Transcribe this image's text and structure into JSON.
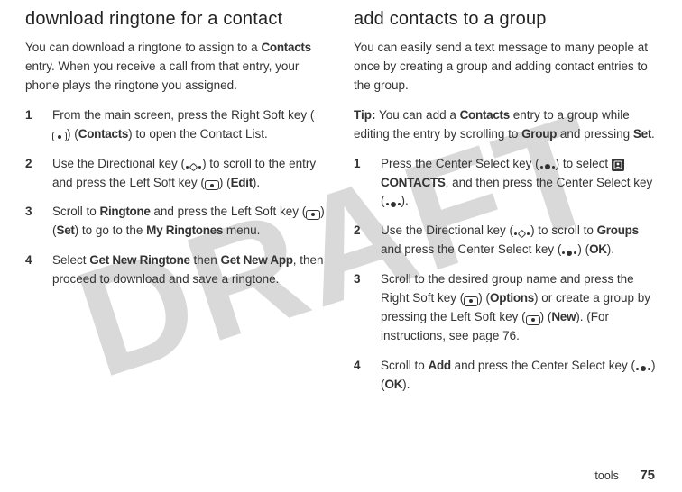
{
  "watermark": "DRAFT",
  "left": {
    "heading": "download ringtone for a contact",
    "intro_parts": [
      "You can download a ringtone to assign to a ",
      "Contacts",
      " entry. When you receive a call from that entry, your phone plays the ringtone you assigned."
    ],
    "steps": [
      {
        "n": "1",
        "parts": [
          "From the main screen, press the Right Soft key (",
          "ICON_SOFT",
          ") (",
          "Contacts",
          ") to open the Contact List."
        ]
      },
      {
        "n": "2",
        "parts": [
          "Use the Directional key (",
          "ICON_DIR",
          ") to scroll to the entry and press the Left Soft key (",
          "ICON_SOFT",
          ") (",
          "Edit",
          ")."
        ]
      },
      {
        "n": "3",
        "parts": [
          "Scroll to ",
          "Ringtone",
          " and press the Left Soft key (",
          "ICON_SOFT",
          ") (",
          "Set",
          ") to go to the ",
          "My Ringtones",
          " menu."
        ]
      },
      {
        "n": "4",
        "parts": [
          "Select ",
          "Get New Ringtone",
          " then ",
          "Get New App",
          ", then proceed to download and save a ringtone."
        ]
      }
    ]
  },
  "right": {
    "heading": "add contacts to a group",
    "intro": "You can easily send a text message to many people at once by creating a group and adding contact entries to the group.",
    "tip_parts": [
      "Tip:",
      " You can add a ",
      "Contacts",
      " entry to a group while editing the entry by scrolling to ",
      "Group",
      " and pressing ",
      "Set",
      "."
    ],
    "steps": [
      {
        "n": "1",
        "parts": [
          "Press the Center Select key (",
          "ICON_SEL",
          ") to select ",
          "ICON_CONTACTS",
          "CONTACTS",
          ", and then press the Center Select key (",
          "ICON_SEL",
          ")."
        ]
      },
      {
        "n": "2",
        "parts": [
          "Use the Directional key (",
          "ICON_DIR",
          ") to scroll to ",
          "Groups",
          " and press the Center Select key (",
          "ICON_SEL",
          ") (",
          "OK",
          ")."
        ]
      },
      {
        "n": "3",
        "parts": [
          "Scroll to the desired group name and press the Right Soft key (",
          "ICON_SOFT",
          ") (",
          "Options",
          ") or create a group by pressing the Left Soft key (",
          "ICON_SOFT",
          ") (",
          "New",
          "). (For instructions, see page 76."
        ]
      },
      {
        "n": "4",
        "parts": [
          "Scroll to ",
          "Add",
          " and press the Center Select key (",
          "ICON_SEL",
          ") (",
          "OK",
          ")."
        ]
      }
    ]
  },
  "footer": {
    "section": "tools",
    "page": "75"
  }
}
